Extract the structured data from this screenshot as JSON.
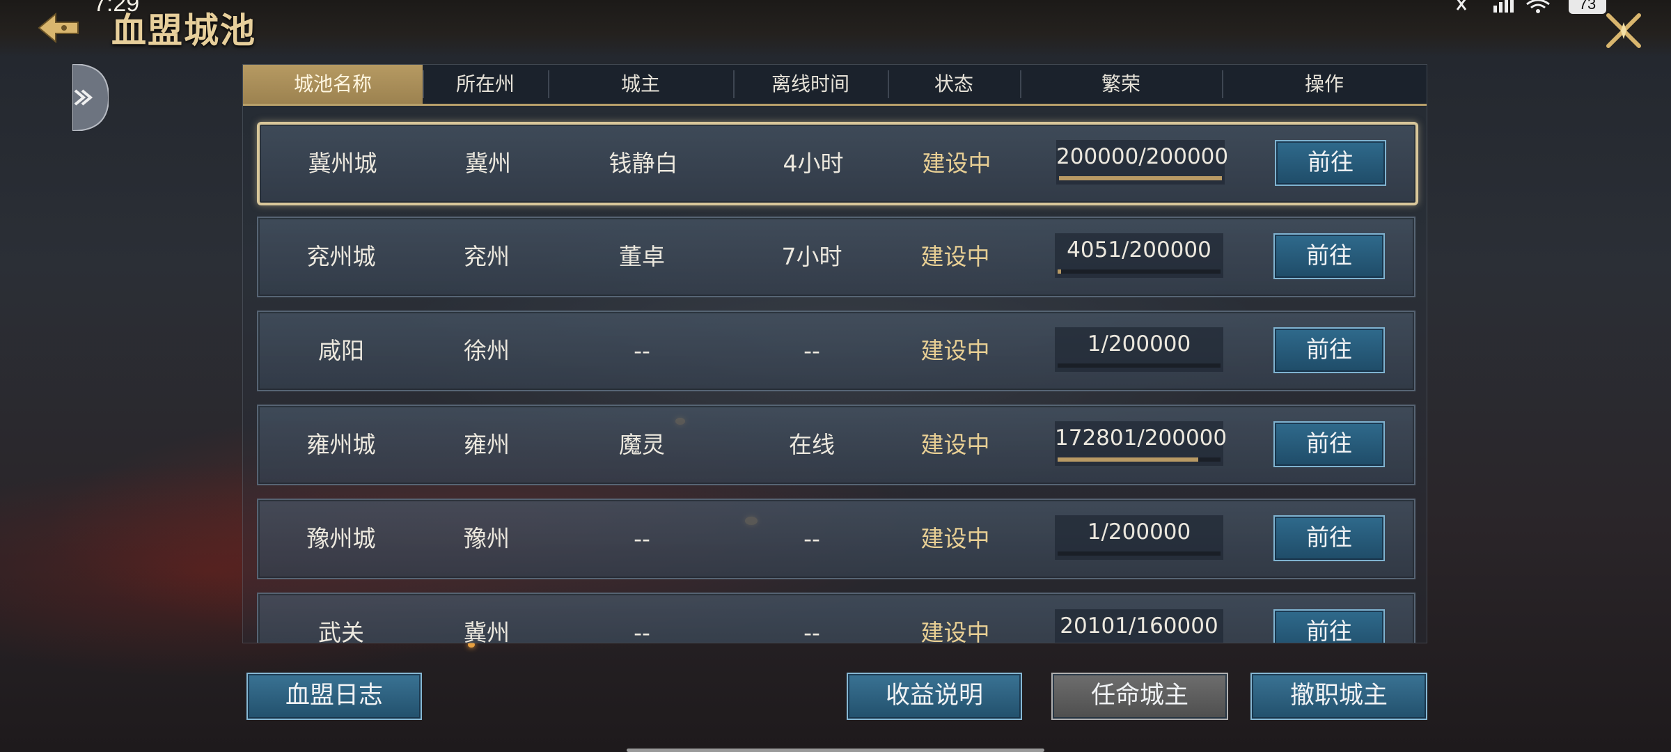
{
  "status_bar": {
    "time": "7:29",
    "battery": "73"
  },
  "header": {
    "title": "血盟城池"
  },
  "table": {
    "columns": [
      "城池名称",
      "所在州",
      "城主",
      "离线时间",
      "状态",
      "繁荣",
      "操作"
    ],
    "active_column": 0,
    "rows": [
      {
        "name": "冀州城",
        "province": "冀州",
        "lord": "钱静白",
        "offline": "4小时",
        "status": "建设中",
        "prosperity": "200000/200000",
        "progress": 1.0,
        "action": "前往",
        "selected": true
      },
      {
        "name": "兖州城",
        "province": "兖州",
        "lord": "董卓",
        "offline": "7小时",
        "status": "建设中",
        "prosperity": "4051/200000",
        "progress": 0.02,
        "action": "前往"
      },
      {
        "name": "咸阳",
        "province": "徐州",
        "lord": "--",
        "offline": "--",
        "status": "建设中",
        "prosperity": "1/200000",
        "progress": 0.0,
        "action": "前往"
      },
      {
        "name": "雍州城",
        "province": "雍州",
        "lord": "魔灵",
        "offline": "在线",
        "status": "建设中",
        "prosperity": "172801/200000",
        "progress": 0.864,
        "action": "前往"
      },
      {
        "name": "豫州城",
        "province": "豫州",
        "lord": "--",
        "offline": "--",
        "status": "建设中",
        "prosperity": "1/200000",
        "progress": 0.0,
        "action": "前往"
      },
      {
        "name": "武关",
        "province": "冀州",
        "lord": "--",
        "offline": "--",
        "status": "建设中",
        "prosperity": "20101/160000",
        "progress": 0.126,
        "action": "前往"
      }
    ]
  },
  "buttons": {
    "log": "血盟日志",
    "income_info": "收益说明",
    "appoint": "任命城主",
    "dismiss": "撤职城主"
  },
  "colors": {
    "gold": "#e7cf9b",
    "status": "#e8cf94",
    "button_blue": "#2f6a8c",
    "progress_fill": "#b89a64"
  }
}
